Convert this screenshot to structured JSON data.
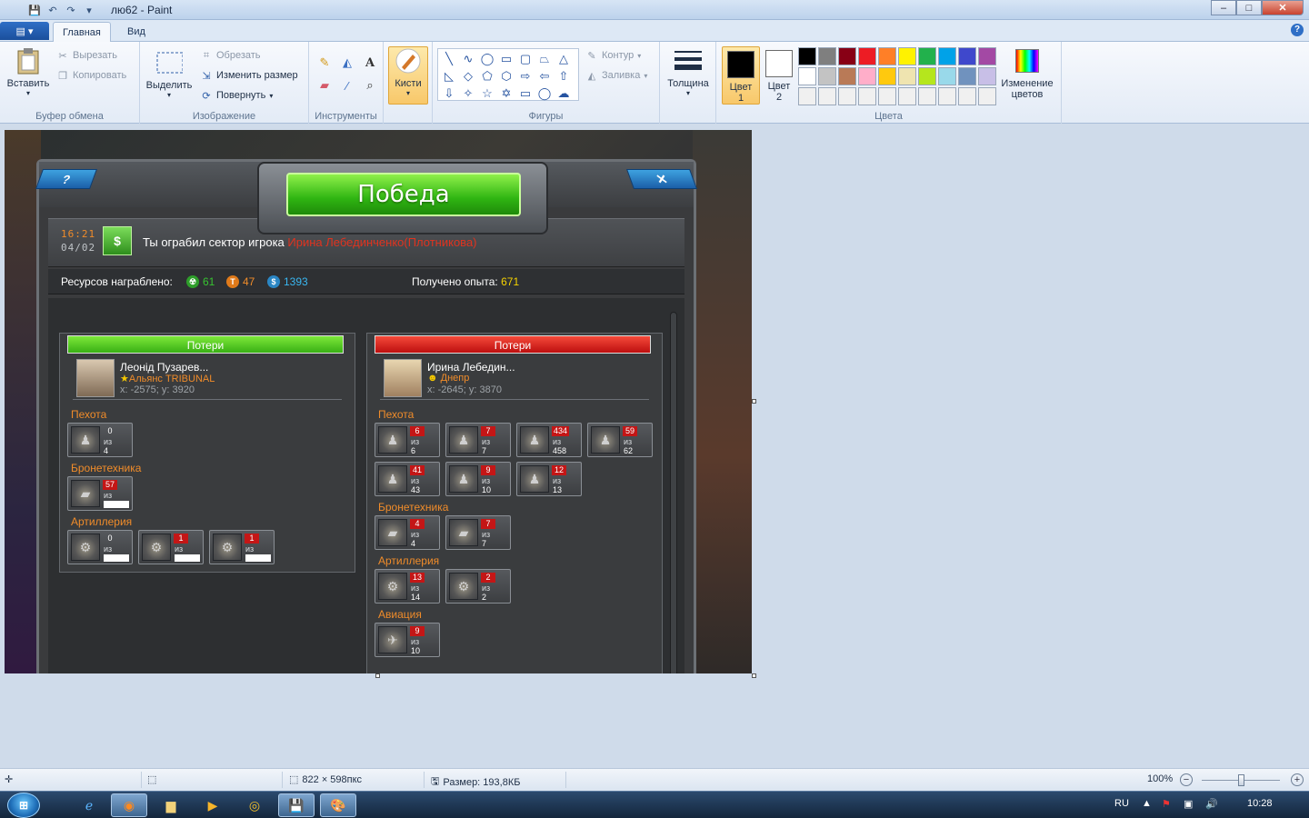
{
  "window": {
    "title": "лю62 - Paint",
    "minimize": "–",
    "maximize": "□",
    "close": "✕"
  },
  "qat": {
    "save_icon": "save-icon",
    "undo_icon": "undo-icon",
    "redo_icon": "redo-icon",
    "dropdown": "▾"
  },
  "tabs": {
    "file": "▤ ▾",
    "home": "Главная",
    "view": "Вид",
    "help": "?"
  },
  "clipboard": {
    "paste": "Вставить",
    "cut": "Вырезать",
    "copy": "Копировать",
    "label": "Буфер обмена"
  },
  "image": {
    "select": "Выделить",
    "crop": "Обрезать",
    "resize": "Изменить размер",
    "rotate": "Повернуть",
    "label": "Изображение"
  },
  "tools": {
    "label": "Инструменты"
  },
  "brushes": {
    "label": "Кисти"
  },
  "shapes": {
    "outline": "Контур",
    "fill": "Заливка",
    "label": "Фигуры"
  },
  "size": {
    "label": "Толщина"
  },
  "colors": {
    "color1": "Цвет 1",
    "color2": "Цвет 2",
    "edit": "Изменение цветов",
    "label": "Цвета",
    "palette": [
      "#000000",
      "#7f7f7f",
      "#880015",
      "#ed1c24",
      "#ff7f27",
      "#fff200",
      "#22b14c",
      "#00a2e8",
      "#3f48cc",
      "#a349a4",
      "#ffffff",
      "#c3c3c3",
      "#b97a57",
      "#ffaec9",
      "#ffc90e",
      "#efe4b0",
      "#b5e61d",
      "#99d9ea",
      "#7092be",
      "#c8bfe7",
      "#f0f0f0",
      "#f0f0f0",
      "#f0f0f0",
      "#f0f0f0",
      "#f0f0f0",
      "#f0f0f0",
      "#f0f0f0",
      "#f0f0f0",
      "#f0f0f0",
      "#f0f0f0"
    ]
  },
  "game": {
    "title": "Победа",
    "help": "?",
    "close": "✕",
    "time": "16:21",
    "date": "04/02",
    "robbed_text": "Ты ограбил сектор игрока ",
    "enemy_name": "Ирина Лебединченко(Плотникова)",
    "resources_label": "Ресурсов награблено:",
    "res1": "61",
    "res2": "47",
    "res3": "1393",
    "xp_label": "Получено опыта:",
    "xp_value": "671",
    "left": {
      "header": "Потери",
      "name": "Леонід Пузарев...",
      "alliance": "Альянс TRIBUNAL",
      "coords": "x: -2575; y: 3920",
      "cat_infantry": "Пехота",
      "cat_armor": "Бронетехника",
      "cat_artillery": "Артиллерия",
      "of": "из",
      "infantry": [
        {
          "lost": "0",
          "total": "4"
        }
      ],
      "armor": [
        {
          "lost": "57",
          "total": ""
        }
      ],
      "artillery": [
        {
          "lost": "0",
          "total": ""
        },
        {
          "lost": "1",
          "total": ""
        },
        {
          "lost": "1",
          "total": ""
        }
      ]
    },
    "right": {
      "header": "Потери",
      "name": "Ирина Лебедин...",
      "alliance": "Днепр",
      "coords": "x: -2645; y: 3870",
      "cat_infantry": "Пехота",
      "cat_armor": "Бронетехника",
      "cat_artillery": "Артиллерия",
      "cat_air": "Авиация",
      "of": "из",
      "infantry": [
        {
          "lost": "6",
          "total": "6"
        },
        {
          "lost": "7",
          "total": "7"
        },
        {
          "lost": "434",
          "total": "458"
        },
        {
          "lost": "59",
          "total": "62"
        },
        {
          "lost": "41",
          "total": "43"
        },
        {
          "lost": "9",
          "total": "10"
        },
        {
          "lost": "12",
          "total": "13"
        }
      ],
      "armor": [
        {
          "lost": "4",
          "total": "4"
        },
        {
          "lost": "7",
          "total": "7"
        }
      ],
      "artillery": [
        {
          "lost": "13",
          "total": "14"
        },
        {
          "lost": "2",
          "total": "2"
        }
      ],
      "air": [
        {
          "lost": "9",
          "total": "10"
        }
      ]
    }
  },
  "status": {
    "dimensions": "822 × 598пкс",
    "filesize": "Размер: 193,8КБ",
    "zoom": "100%"
  },
  "taskbar": {
    "lang": "RU",
    "clock": "10:28",
    "start": "⊞"
  }
}
